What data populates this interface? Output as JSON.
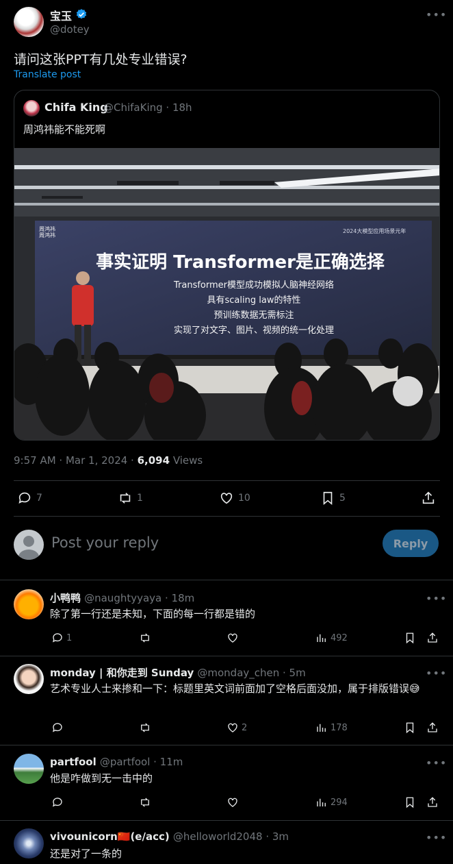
{
  "post": {
    "author_name": "宝玉",
    "author_handle": "@dotey",
    "text": "请问这张PPT有几处专业错误?",
    "translate_label": "Translate post",
    "time": "9:57 AM · Mar 1, 2024 · ",
    "views_count": "6,094",
    "views_label": " Views",
    "more_icon": "more-icon"
  },
  "quote": {
    "author_name": "Chifa King",
    "author_handle": "@ChifaKing · 18h",
    "text": "周鸿祎能不能死啊",
    "slide": {
      "corner_left": "周鸿祎\n周鸿祎",
      "corner_right": "2024大模型应用场景元年",
      "title": "事实证明 Transformer是正确选择",
      "lines": [
        "Transformer模型成功模拟人脑神经网络",
        "具有scaling law的特性",
        "预训练数据无需标注",
        "实现了对文字、图片、视频的统一化处理"
      ]
    }
  },
  "actions": {
    "replies": "7",
    "reposts": "1",
    "likes": "10",
    "bookmarks": "5"
  },
  "composer": {
    "placeholder": "Post your reply",
    "reply_button": "Reply"
  },
  "comments": [
    {
      "name": "小鸭鸭",
      "meta": "@naughtyyaya · 18m",
      "text": "除了第一行还是未知，下面的每一行都是错的",
      "replies": "1",
      "reposts": "",
      "likes": "",
      "views": "492"
    },
    {
      "name": "monday | 和你走到 Sunday",
      "meta": "@monday_chen · 5m",
      "text": "艺术专业人士来掺和一下：标题里英文词前面加了空格后面没加，属于排版错误😅",
      "replies": "",
      "reposts": "",
      "likes": "2",
      "views": "178"
    },
    {
      "name": "partfool",
      "meta": "@partfool · 11m",
      "text": "他是咋做到无一击中的",
      "replies": "",
      "reposts": "",
      "likes": "",
      "views": "294"
    },
    {
      "name": "vivounicorn🇨🇳(e/acc)",
      "meta": "@helloworld2048 · 3m",
      "text": "还是对了一条的"
    }
  ],
  "colors": {
    "background": "#000000",
    "accent": "#1d9bf0",
    "muted": "#71767b",
    "divider": "#2f3336"
  }
}
